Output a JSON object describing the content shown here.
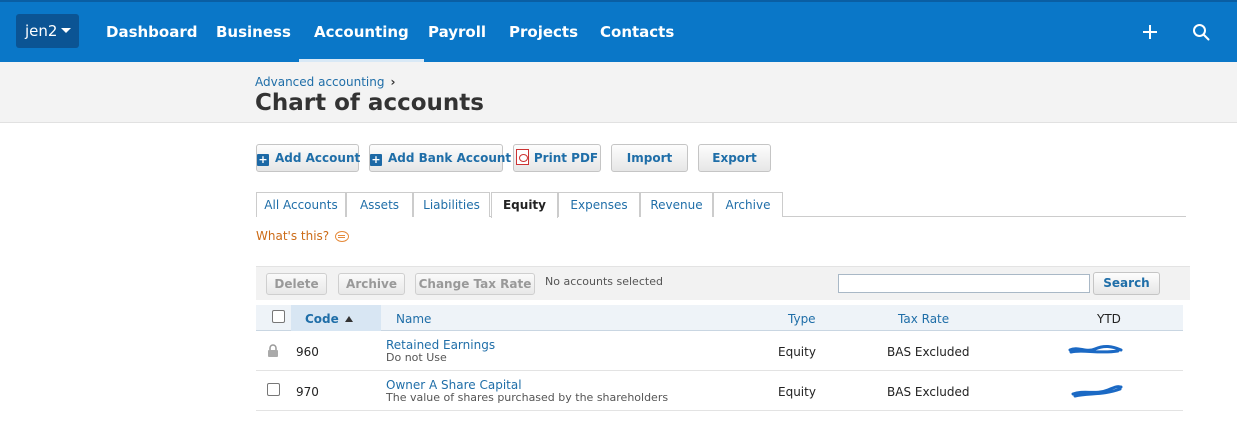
{
  "nav": {
    "org_label": "jen2",
    "items": [
      "Dashboard",
      "Business",
      "Accounting",
      "Payroll",
      "Projects",
      "Contacts"
    ]
  },
  "header": {
    "breadcrumb": "Advanced accounting",
    "title": "Chart of accounts"
  },
  "actions": {
    "add_account": "Add Account",
    "add_bank_account": "Add Bank Account",
    "print_pdf": "Print PDF",
    "import": "Import",
    "export": "Export"
  },
  "tabs": [
    "All Accounts",
    "Assets",
    "Liabilities",
    "Equity",
    "Expenses",
    "Revenue",
    "Archive"
  ],
  "active_tab": "Equity",
  "whats_this": "What's this?",
  "toolbar": {
    "delete": "Delete",
    "archive": "Archive",
    "change_tax_rate": "Change Tax Rate",
    "status": "No accounts selected",
    "search_value": "",
    "search_button": "Search"
  },
  "table": {
    "columns": {
      "code": "Code",
      "name": "Name",
      "type": "Type",
      "tax_rate": "Tax Rate",
      "ytd": "YTD"
    },
    "sort": "Code ascending",
    "rows": [
      {
        "code": "960",
        "name": "Retained Earnings",
        "description": "Do not Use",
        "type": "Equity",
        "tax_rate": "BAS Excluded",
        "locked": true
      },
      {
        "code": "970",
        "name": "Owner A Share Capital",
        "description": "The value of shares purchased by the shareholders",
        "type": "Equity",
        "tax_rate": "BAS Excluded",
        "locked": false
      }
    ]
  },
  "colors": {
    "nav_bg": "#0a77c8",
    "link": "#1f6ea8",
    "accent_orange": "#cc6b17"
  }
}
